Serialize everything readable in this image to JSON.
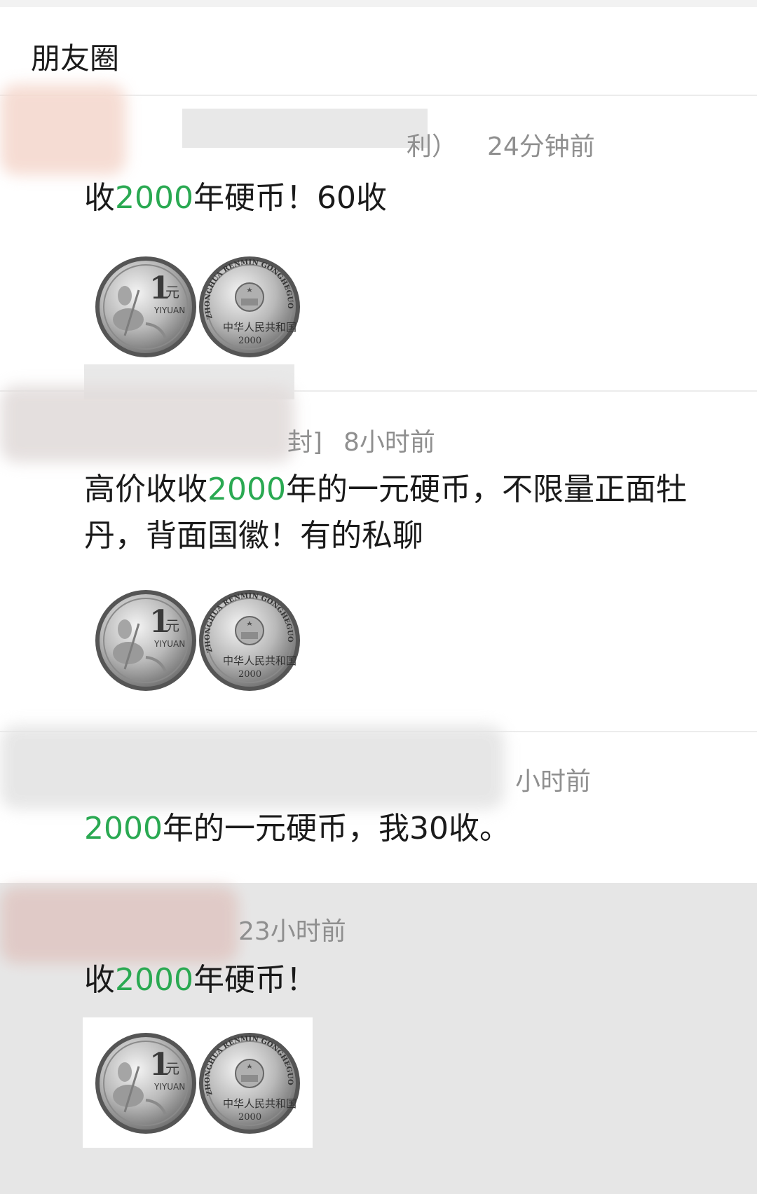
{
  "header": {
    "title": "朋友圈"
  },
  "posts": [
    {
      "meta_name_fragment": "利）",
      "meta_time": "24分钟前",
      "text_before": "收",
      "text_highlight": "2000",
      "text_after": "年硬币！60收",
      "has_image": true
    },
    {
      "meta_name_fragment": "封]",
      "meta_time": "8小时前",
      "text_before": "高价收收",
      "text_highlight": "2000",
      "text_after": "年的一元硬币，不限量正面牡丹，背面国徽！有的私聊",
      "has_image": true
    },
    {
      "meta_time": "小时前",
      "text_highlight": "2000",
      "text_after": "年的一元硬币，我30收。",
      "has_image": false
    },
    {
      "meta_time": "23小时前",
      "text_before": "收",
      "text_highlight": "2000",
      "text_after": "年硬币！",
      "has_image": true
    }
  ],
  "coin": {
    "front_value": "1",
    "front_unit": "元",
    "front_pinyin": "YIYUAN",
    "back_arc": "ZHONGHUA RENMIN GONGHEGUO",
    "back_country": "中华人民共和国",
    "back_year": "2000"
  },
  "colors": {
    "highlight": "#2aa952",
    "meta": "#8f8f8f",
    "background": "#f2f2f2"
  }
}
